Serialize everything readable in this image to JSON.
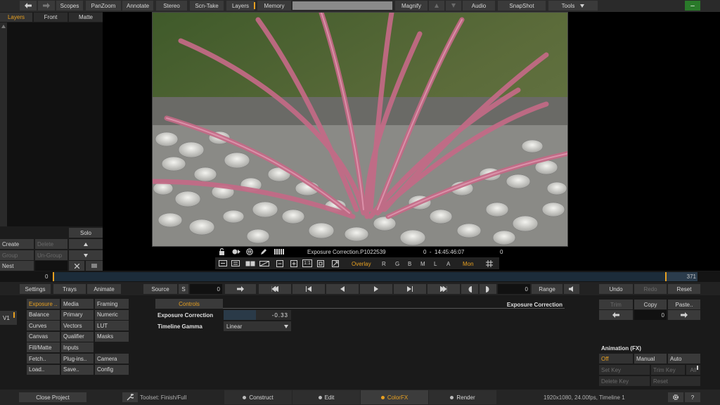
{
  "top_toolbar": {
    "scopes": "Scopes",
    "panzoom": "PanZoom",
    "annotate": "Annotate",
    "stereo": "Stereo",
    "scn_take": "Scn-Take",
    "layers": "Layers",
    "memory": "Memory",
    "magnify": "Magnify",
    "audio": "Audio",
    "snapshot": "SnapShot",
    "tools": "Tools",
    "minimize": "–"
  },
  "layers_panel": {
    "tabs": [
      "Layers",
      "Front",
      "Matte"
    ],
    "solo": "Solo",
    "create": "Create",
    "delete": "Delete",
    "group": "Group",
    "ungroup": "Un-Group",
    "nest": "Nest"
  },
  "viewer_info": {
    "clip_name": "Exposure Correction.P1022539",
    "timecode": "0  -  14:45:46:07",
    "frame_value": "0"
  },
  "viewer_tools": {
    "one_to_one": "1:1",
    "overlay": "Overlay",
    "channels": [
      "R",
      "G",
      "B",
      "M",
      "L",
      "A"
    ],
    "mon": "Mon"
  },
  "timeline": {
    "start": "0",
    "end": "371"
  },
  "transport": {
    "settings": "Settings",
    "trays": "Trays",
    "animate": "Animate",
    "source": "Source",
    "s": "S",
    "frame": "0",
    "frame2": "0",
    "range": "Range",
    "undo": "Undo",
    "redo": "Redo",
    "reset": "Reset"
  },
  "version": {
    "label": "V1"
  },
  "menu_grid": {
    "col1": [
      "Exposure ..",
      "Balance",
      "Curves",
      "Canvas",
      "Fill/Matte",
      "Fetch..",
      "Load.."
    ],
    "col2": [
      "Media",
      "Primary",
      "Vectors",
      "Qualifier",
      "Inputs",
      "Plug-ins..",
      "Save.."
    ],
    "col3": [
      "Framing",
      "Numeric",
      "LUT",
      "Masks",
      "",
      "Camera",
      "Config"
    ]
  },
  "controls": {
    "tab": "Controls",
    "title": "Exposure Correction",
    "exposure_label": "Exposure Correction",
    "exposure_value": "-0.33",
    "gamma_label": "Timeline Gamma",
    "gamma_value": "Linear"
  },
  "right_panel": {
    "trim": "Trim",
    "copy": "Copy",
    "paste": "Paste..",
    "value": "0",
    "animation_title": "Animation (FX)",
    "off": "Off",
    "manual": "Manual",
    "auto": "Auto",
    "set_key": "Set Key",
    "trim_key": "Trim Key",
    "all": "All",
    "delete_key": "Delete Key",
    "reset": "Reset"
  },
  "bottom_bar": {
    "close_project": "Close Project",
    "toolset": "Toolset: Finish/Full",
    "tabs": [
      "Construct",
      "Edit",
      "ColorFX",
      "Render"
    ],
    "status": "1920x1080, 24.00fps, Timeline 1",
    "help": "?"
  },
  "colors": {
    "accent": "#e8a020",
    "green_button": "#2a7a2a",
    "timeline_fill": "#1c2c3a"
  }
}
